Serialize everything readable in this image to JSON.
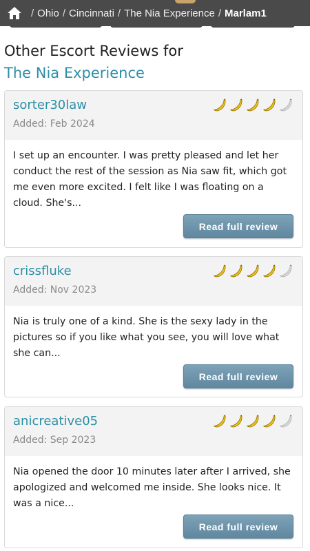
{
  "breadcrumb": {
    "items": [
      "Ohio",
      "Cincinnati",
      "The Nia Experience"
    ],
    "current": "Marlam1"
  },
  "section": {
    "title_prefix": "Other Escort Reviews for ",
    "title_link": "The Nia Experience"
  },
  "reviews": [
    {
      "reviewer": "sorter30law",
      "added": "Added: Feb 2024",
      "rating": 4,
      "rating_max": 5,
      "excerpt": "I set up an encounter. I was pretty pleased and let her conduct the rest of the session as Nia saw fit, which got me even more excited. I felt like I was floating on a cloud. She's...",
      "button": "Read full review"
    },
    {
      "reviewer": "crissfluke",
      "added": "Added: Nov 2023",
      "rating": 4,
      "rating_max": 5,
      "excerpt": "Nia is truly one of a kind. She is the sexy lady in the pictures so if you like what you see, you will love what she can...",
      "button": "Read full review"
    },
    {
      "reviewer": "anicreative05",
      "added": "Added: Sep 2023",
      "rating": 4,
      "rating_max": 5,
      "excerpt": "Nia opened the door 10 minutes later after I arrived, she apologized and welcomed me inside. She looks nice. It was a nice...",
      "button": "Read full review"
    }
  ],
  "colors": {
    "accent": "#2b8fa6",
    "banana_on": "#f2c318",
    "banana_off": "#d9d9d9",
    "button": "#6b90a7"
  },
  "icons": {
    "home": "home-icon",
    "rating": "banana-icon"
  }
}
